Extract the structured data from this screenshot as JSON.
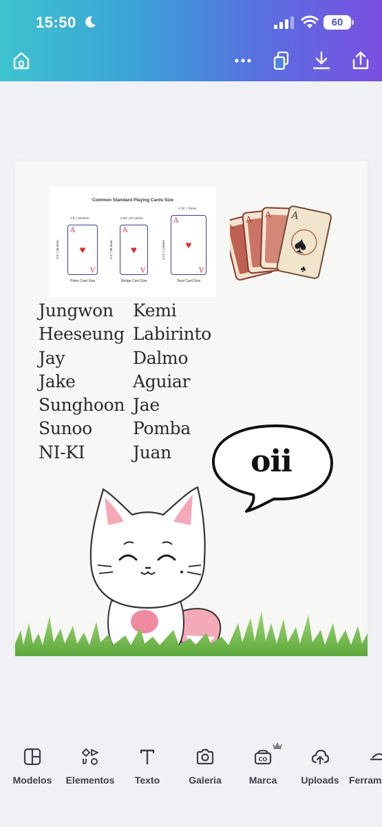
{
  "status_bar": {
    "time": "15:50",
    "battery": "60"
  },
  "toolbar": {
    "home": "home-icon",
    "more": "more-icon",
    "pages": "pages-icon",
    "download": "download-icon",
    "share": "share-icon"
  },
  "design": {
    "size_chart": {
      "title": "Common Standard Playing Cards Size",
      "cards": [
        {
          "label": "Poker Card Size",
          "width": "2.5\" | 63.5mm",
          "height": "3.5\" | 88.9mm"
        },
        {
          "label": "Bridge Card Size",
          "width": "2.25\" | 57.15mm",
          "height": "3.5\" | 88.9mm"
        },
        {
          "label": "Tarot Card Size",
          "width": "2.75\" | 70mm",
          "height": "4.74\" | 120mm"
        }
      ]
    },
    "names_left": [
      "Jungwon",
      "Heeseung",
      "Jay",
      "Jake",
      "Sunghoon",
      "Sunoo",
      "NI-KI"
    ],
    "names_right": [
      "Kemi",
      "Labirinto",
      "Dalmo",
      "Aguiar",
      "Jae",
      "Pomba",
      "Juan"
    ],
    "speech_bubble": "oii"
  },
  "bottom_nav": [
    {
      "label": "Modelos",
      "icon": "templates-icon"
    },
    {
      "label": "Elementos",
      "icon": "elements-icon"
    },
    {
      "label": "Texto",
      "icon": "text-icon"
    },
    {
      "label": "Galeria",
      "icon": "camera-icon"
    },
    {
      "label": "Marca",
      "icon": "brand-icon"
    },
    {
      "label": "Uploads",
      "icon": "upload-cloud-icon"
    },
    {
      "label": "Ferram",
      "icon": "tools-icon"
    }
  ],
  "colors": {
    "header_start": "#3fc3cf",
    "header_end": "#7a4fe0",
    "heart": "#e02b2b",
    "nav_text": "#3c3f47"
  }
}
